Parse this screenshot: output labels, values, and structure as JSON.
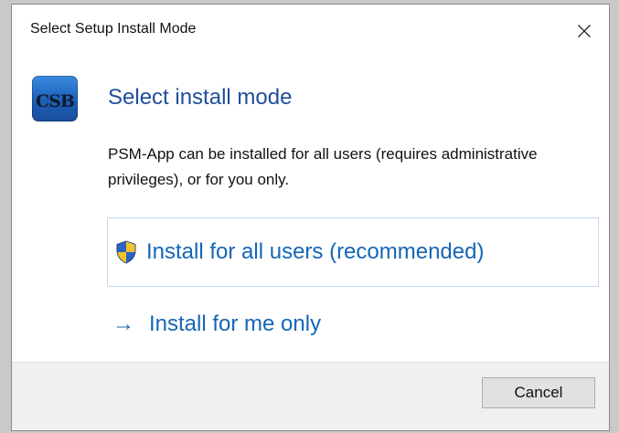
{
  "window": {
    "title": "Select Setup Install Mode",
    "close_icon": "close-icon"
  },
  "header": {
    "logo_text": "CSB",
    "heading": "Select install mode"
  },
  "description": "PSM-App can be installed for all users (requires administrative privileges), or for you only.",
  "options": {
    "all_users": {
      "icon": "uac-shield-icon",
      "label": "Install for all users (recommended)"
    },
    "me_only": {
      "icon": "arrow-right-icon",
      "arrow": "→",
      "label": "Install for me only"
    }
  },
  "footer": {
    "cancel_label": "Cancel"
  },
  "colors": {
    "link": "#1566b6",
    "heading": "#1f4e9a",
    "footer_bg": "#f0f0f0",
    "button_bg": "#e1e1e1"
  }
}
